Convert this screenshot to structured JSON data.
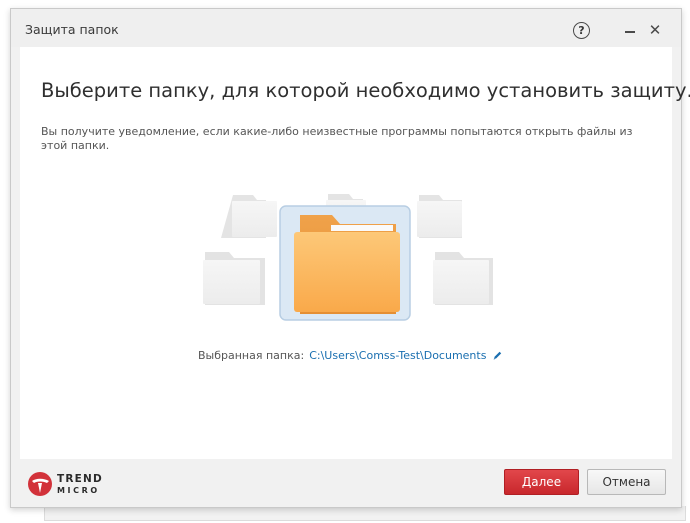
{
  "window": {
    "title": "Защита папок"
  },
  "content": {
    "heading": "Выберите папку, для которой необходимо установить защиту.",
    "description": "Вы получите уведомление, если какие-либо неизвестные программы попытаются открыть файлы из этой папки."
  },
  "selection": {
    "label": "Выбранная папка:",
    "path": "C:\\Users\\Comss-Test\\Documents"
  },
  "footer": {
    "logo_line1": "TREND",
    "logo_line2": "MICRO",
    "next_label": "Далее",
    "cancel_label": "Отмена"
  },
  "icons": {
    "help": "help-icon",
    "minimize": "minimize-icon",
    "close": "close-icon",
    "folder_selected": "folder-icon",
    "edit": "pencil-icon",
    "logo": "trend-micro-logo"
  },
  "colors": {
    "accent_red": "#d2323a",
    "link_blue": "#1a6fb0",
    "folder_orange": "#fbb45a"
  }
}
